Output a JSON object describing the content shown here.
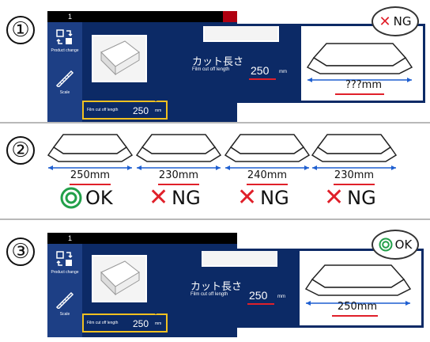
{
  "steps": {
    "step1_number": "①",
    "step2_number": "②",
    "step3_number": "③"
  },
  "screen": {
    "tab_number": "1",
    "product_change_label": "Product change",
    "scale_label": "Scale",
    "field_label": "Film cut off length",
    "field_value": "250",
    "field_unit": "mm"
  },
  "callout": {
    "title_jp": "カット長さ",
    "title_en": "Film cut off length",
    "value": "250",
    "unit": "mm"
  },
  "step1": {
    "measure": "???mm",
    "verdict": "NG"
  },
  "step2": {
    "items": [
      {
        "measure": "250mm",
        "verdict": "OK"
      },
      {
        "measure": "230mm",
        "verdict": "NG"
      },
      {
        "measure": "240mm",
        "verdict": "NG"
      },
      {
        "measure": "230mm",
        "verdict": "NG"
      }
    ]
  },
  "step3": {
    "measure": "250mm",
    "verdict": "OK"
  },
  "colors": {
    "screen_blue": "#0c2a66",
    "highlight_yellow": "#f0c020",
    "ng_red": "#e0202a",
    "ok_green": "#22a04a",
    "dim_blue": "#1f5fd0"
  }
}
